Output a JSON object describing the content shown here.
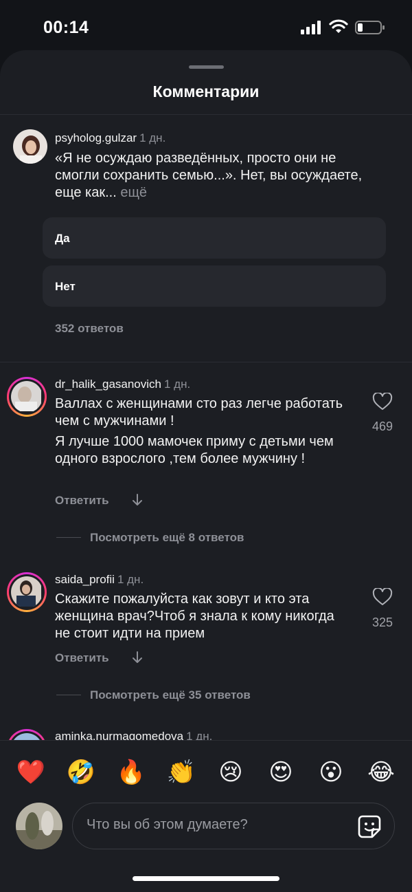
{
  "status_bar": {
    "time": "00:14"
  },
  "sheet": {
    "title": "Комментарии"
  },
  "pinned": {
    "username": "psyholog.gulzar",
    "age": "1 дн.",
    "text": "«Я не осуждаю разведённых, просто они не смогли сохранить семью...». Нет, вы осуждаете, еще как...",
    "more": "ещё",
    "poll_options": [
      "Да",
      "Нет"
    ],
    "replies": "352 ответов"
  },
  "comments": [
    {
      "username": "dr_halik_gasanovich",
      "age": "1 дн.",
      "text1": "Валлах с женщинами сто раз легче работать чем с мужчинами !",
      "text2": "Я лучше 1000 мамочек приму с детьми чем одного взрослого ,тем более мужчину !",
      "likes": "469",
      "reply": "Ответить",
      "view_more": "Посмотреть ещё 8 ответов"
    },
    {
      "username": "saida_profii",
      "age": "1 дн.",
      "text1": "Скажите пожалуйста как зовут и кто эта женщина врач?Чтоб я знала к кому никогда не стоит идти на прием",
      "likes": "325",
      "reply": "Ответить",
      "view_more": "Посмотреть ещё 35 ответов"
    },
    {
      "username": "aminka.nurmagomedova",
      "age": "1 дн."
    }
  ],
  "reactions": [
    "❤️",
    "🤣",
    "🔥",
    "👏",
    "😢",
    "😍",
    "😮",
    "😂"
  ],
  "composer": {
    "placeholder": "Что вы об этом думаете?"
  },
  "colors": {
    "background": "#1c1e23",
    "muted": "#8e9097",
    "story_ring": "#d62fd6"
  }
}
